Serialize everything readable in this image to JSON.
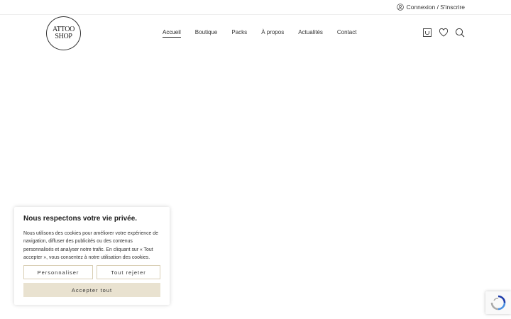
{
  "topbar": {
    "account_label": "Connexion / S'inscrire",
    "account_icon": "user-circle-icon"
  },
  "logo": {
    "line1": "ATTOO",
    "line2": "SHOP"
  },
  "nav": {
    "items": [
      {
        "label": "Accueil",
        "active": true
      },
      {
        "label": "Boutique"
      },
      {
        "label": "Packs"
      },
      {
        "label": "À propos"
      },
      {
        "label": "Actualités"
      },
      {
        "label": "Contact"
      }
    ]
  },
  "tools": {
    "icons": [
      "cart-icon",
      "heart-icon",
      "search-icon"
    ]
  },
  "cookie": {
    "title": "Nous respectons votre vie privée.",
    "text": "Nous utilisons des cookies pour améliorer votre expérience de navigation, diffuser des publicités ou des contenus personnalisés et analyser notre trafic. En cliquant sur « Tout accepter », vous consentez à notre utilisation des cookies.",
    "customize_label": "Personnaliser",
    "reject_label": "Tout rejeter",
    "accept_label": "Accepter tout"
  },
  "colors": {
    "accent": "#e9e2d0",
    "border": "#d9cfb5",
    "text": "#1f1f1f"
  }
}
